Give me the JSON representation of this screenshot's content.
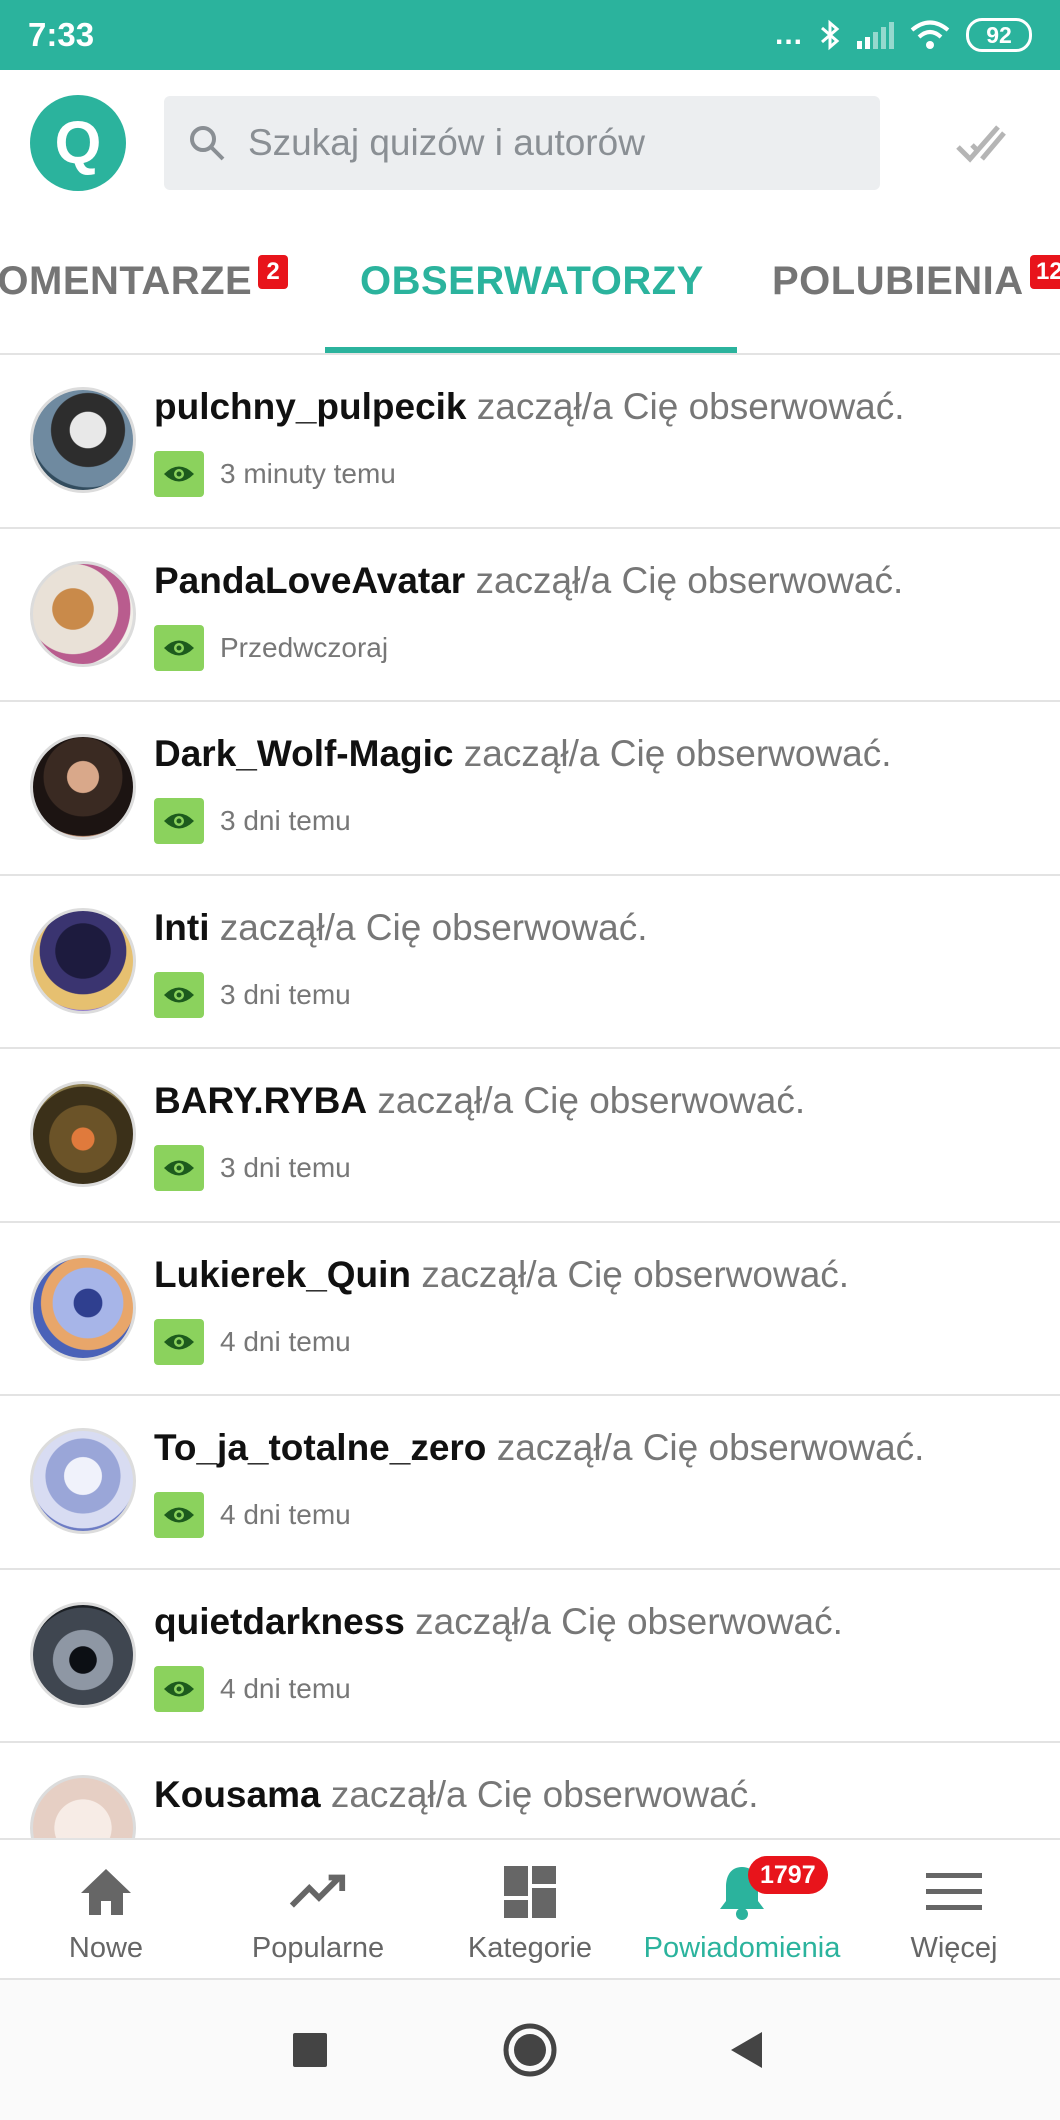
{
  "status_bar": {
    "time": "7:33",
    "battery": "92",
    "dots": "..."
  },
  "search": {
    "placeholder": "Szukaj quizów i autorów"
  },
  "logo": {
    "letter": "Q"
  },
  "tabs": [
    {
      "label": "KOMENTARZE",
      "badge": "2"
    },
    {
      "label": "OBSERWATORZY",
      "badge": ""
    },
    {
      "label": "POLUBIENIA",
      "badge": "12"
    }
  ],
  "notifications": [
    {
      "user": "pulchny_pulpecik",
      "message": "zaczął/a Cię obserwować.",
      "time": "3 minuty temu"
    },
    {
      "user": "PandaLoveAvatar",
      "message": "zaczął/a Cię obserwować.",
      "time": "Przedwczoraj"
    },
    {
      "user": "Dark_Wolf-Magic",
      "message": "zaczął/a Cię obserwować.",
      "time": "3 dni temu"
    },
    {
      "user": "Inti",
      "message": "zaczął/a Cię obserwować.",
      "time": "3 dni temu"
    },
    {
      "user": "BARY.RYBA",
      "message": "zaczął/a Cię obserwować.",
      "time": "3 dni temu"
    },
    {
      "user": "Lukierek_Quin",
      "message": "zaczął/a Cię obserwować.",
      "time": "4 dni temu"
    },
    {
      "user": "To_ja_totalne_zero",
      "message": "zaczął/a Cię obserwować.",
      "time": "4 dni temu"
    },
    {
      "user": "quietdarkness",
      "message": "zaczął/a Cię obserwować.",
      "time": "4 dni temu"
    },
    {
      "user": "Kousama",
      "message": "zaczął/a Cię obserwować.",
      "time": ""
    }
  ],
  "bottom_nav": [
    {
      "label": "Nowe",
      "icon": "home-icon"
    },
    {
      "label": "Popularne",
      "icon": "trending-icon"
    },
    {
      "label": "Kategorie",
      "icon": "dashboard-icon"
    },
    {
      "label": "Powiadomienia",
      "icon": "bell-icon",
      "badge": "1797"
    },
    {
      "label": "Więcej",
      "icon": "menu-icon"
    }
  ],
  "colors": {
    "accent": "#2bb39d",
    "badge": "#e8141b",
    "eye_badge": "#8bd25d"
  }
}
